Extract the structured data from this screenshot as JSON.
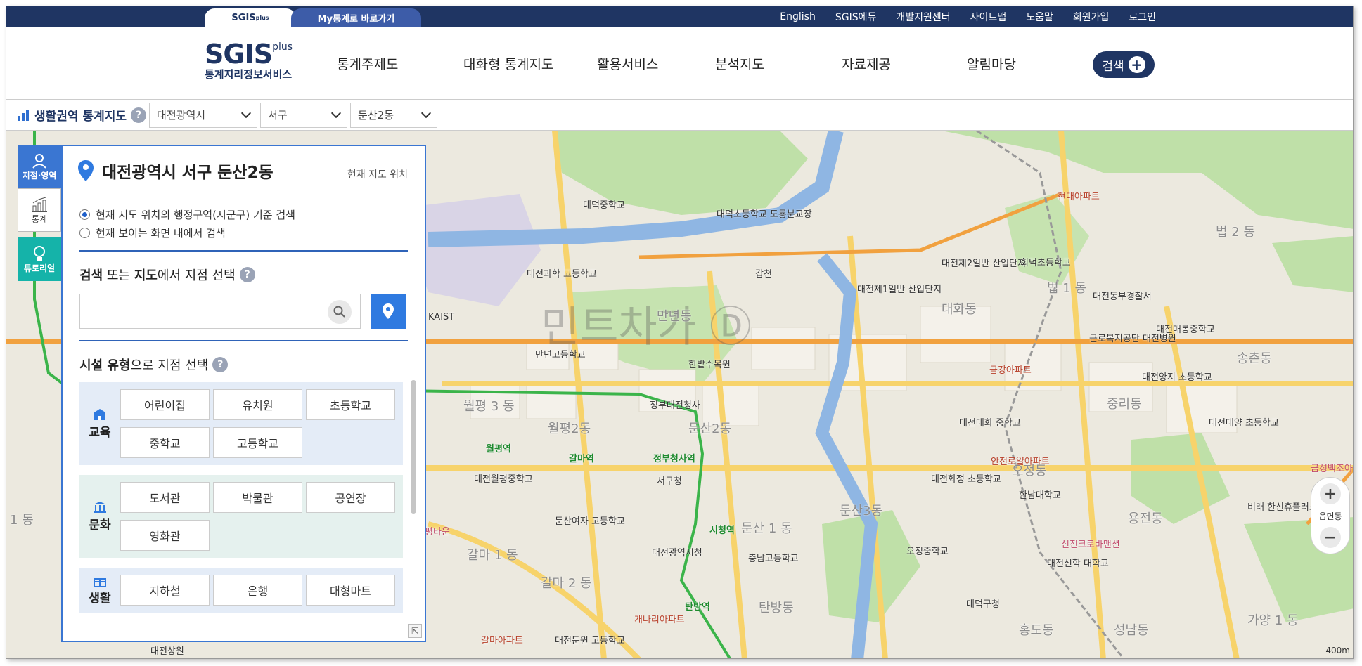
{
  "top_tabs": {
    "sgis": "SGIS",
    "my_tongye": "My통계로 바로가기"
  },
  "top_links": [
    "English",
    "SGIS에듀",
    "개발지원센터",
    "사이트맵",
    "도움말",
    "회원가입",
    "로그인"
  ],
  "logo": {
    "name": "SGIS",
    "plus": "plus",
    "subtitle": "통계지리정보서비스"
  },
  "gnb": [
    "통계주제도",
    "대화형 통계지도",
    "활용서비스",
    "분석지도",
    "자료제공",
    "알림마당"
  ],
  "search_button": "검색",
  "subbar": {
    "title": "생활권역 통계지도",
    "sido": "대전광역시",
    "sigungu": "서구",
    "emd": "둔산2동"
  },
  "rail": {
    "location": "지점·영역",
    "stats": "통계",
    "tutorial": "튜토리얼"
  },
  "panel": {
    "title": "대전광역시 서구 둔산2동",
    "current_location": "현재 지도 위치",
    "radio1": "현재 지도 위치의 행정구역(시군구) 기준 검색",
    "radio2": "현재 보이는 화면 내에서 검색",
    "search_section_a": "검색",
    "search_section_b": " 또는 ",
    "search_section_c": "지도",
    "search_section_d": "에서 지점 선택",
    "search_placeholder": "",
    "facility_a": "시설 유형",
    "facility_b": "으로 지점 선택",
    "categories": [
      {
        "label": "교육",
        "items": [
          "어린이집",
          "유치원",
          "초등학교",
          "중학교",
          "고등학교"
        ]
      },
      {
        "label": "문화",
        "items": [
          "도서관",
          "박물관",
          "공연장",
          "영화관"
        ]
      },
      {
        "label": "생활",
        "items": [
          "지하철",
          "은행",
          "대형마트"
        ]
      }
    ]
  },
  "zoom": {
    "in": "+",
    "label": "읍면동",
    "out": "−"
  },
  "scale": "400m",
  "map_labels": [
    "대덕중학교",
    "대덕초등학교 도룡분교장",
    "대전과학 고등학교",
    "KAIST",
    "만년동",
    "만년고등학교",
    "한밭수목원",
    "갑천",
    "대전제1일반 산업단지",
    "대전제2일반 산업단지",
    "대화동",
    "법 2 동",
    "현대아파트",
    "회덕초등학교",
    "법 1 동",
    "대전동부경찰서",
    "근로복지공단 대전병원",
    "대전매봉중학교",
    "송촌동",
    "금강아파트",
    "대전양지 초등학교",
    "중리동",
    "월평 3 동",
    "월평2동",
    "정부대전청사",
    "둔산2동",
    "대전대화 중학교",
    "대전대양 초등학교",
    "금성백조아",
    "월평역",
    "갈마역",
    "정부청사역",
    "대전월평중학교",
    "서구청",
    "안전로얄아파트",
    "대전화정 초등학교",
    "오정동",
    "한남대학교",
    "용전동",
    "비래 한신휴플러스",
    "둔산여자 고등학교",
    "시청역",
    "둔산 1 동",
    "대전광역시청",
    "둔산3동",
    "갈마 1 동",
    "갈마 2 동",
    "충남고등학교",
    "오정중학교",
    "신진크로바맨션",
    "대전신학 대학교",
    "탄방역",
    "탄방동",
    "개나리아파트",
    "대덕구청",
    "홍도동",
    "성남동",
    "가양 1 동",
    "갈마아파트",
    "대전둔원 고등학교",
    "대전상원",
    "1 동",
    "평타운"
  ],
  "colors": {
    "navy": "#1f3563",
    "blue": "#3a76d2",
    "teal": "#15b3a9",
    "subway": "#3bb44a",
    "river": "#8fb6e3"
  }
}
